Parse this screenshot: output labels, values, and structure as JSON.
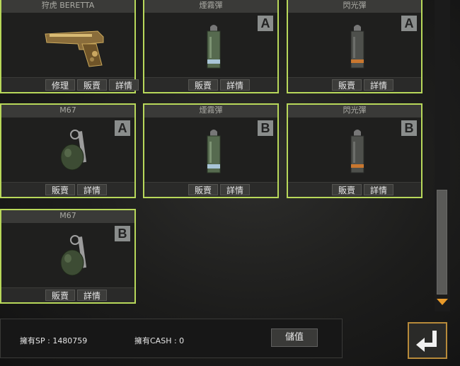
{
  "cards": [
    {
      "title": "狩虎 BERETTA",
      "grade": "",
      "buttons": [
        "修理",
        "販賣",
        "詳情"
      ],
      "icon": "pistol-icon"
    },
    {
      "title": "煙霧彈",
      "grade": "A",
      "buttons": [
        "販賣",
        "詳情"
      ],
      "icon": "smoke-grenade-icon"
    },
    {
      "title": "閃光彈",
      "grade": "A",
      "buttons": [
        "販賣",
        "詳情"
      ],
      "icon": "flash-grenade-icon"
    },
    {
      "title": "M67",
      "grade": "A",
      "buttons": [
        "販賣",
        "詳情"
      ],
      "icon": "frag-grenade-icon"
    },
    {
      "title": "煙霧彈",
      "grade": "B",
      "buttons": [
        "販賣",
        "詳情"
      ],
      "icon": "smoke-grenade-icon"
    },
    {
      "title": "閃光彈",
      "grade": "B",
      "buttons": [
        "販賣",
        "詳情"
      ],
      "icon": "flash-grenade-icon"
    },
    {
      "title": "M67",
      "grade": "B",
      "buttons": [
        "販賣",
        "詳情"
      ],
      "icon": "frag-grenade-icon"
    }
  ],
  "footer": {
    "sp_label": "擁有SP : 1480759",
    "cash_label": "擁有CASH : 0",
    "charge_button": "儲值",
    "back_icon": "return-arrow-icon"
  },
  "colors": {
    "card_border": "#b8d85a",
    "scroll_arrow": "#e89a2a",
    "back_border": "#b78a3a"
  }
}
